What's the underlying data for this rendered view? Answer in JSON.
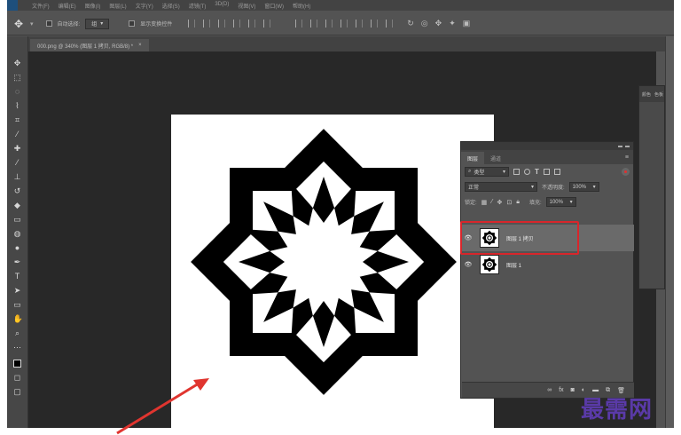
{
  "app": {
    "menus": [
      "文件(F)",
      "编辑(E)",
      "图像(I)",
      "图层(L)",
      "文字(Y)",
      "选择(S)",
      "滤镜(T)",
      "3D(D)",
      "视图(V)",
      "窗口(W)",
      "帮助(H)"
    ]
  },
  "options": {
    "auto_select_label": "自动选择:",
    "auto_select_value": "组",
    "show_transform_label": "显示变换控件"
  },
  "document": {
    "tab_title": "000.png @ 340% (图层 1 拷贝, RGB/8) *",
    "close_glyph": "×"
  },
  "colors": {
    "highlight": "#d8262b",
    "arrow": "#e0352f",
    "watermark": "#5a3aa8",
    "toggle_dot": "#e03030"
  },
  "panel2": {
    "tab_a": "颜色",
    "tab_b": "色板"
  },
  "layers_panel": {
    "tab_layers": "图层",
    "tab_channels": "通道",
    "menu_icon": "hamburger-menu-icon",
    "filter_kind_label": "类型",
    "blend_mode": "正常",
    "opacity_label": "不透明度:",
    "opacity_value": "100%",
    "lock_label": "锁定:",
    "fill_label": "填充:",
    "fill_value": "100%",
    "layers": [
      {
        "name": "图层 1 拷贝",
        "selected": true,
        "visible": true
      },
      {
        "name": "图层 1",
        "selected": false,
        "visible": true
      }
    ],
    "footer_icons": [
      "link-icon",
      "fx-icon",
      "mask-icon",
      "adjustment-icon",
      "folder-icon",
      "new-layer-icon",
      "trash-icon"
    ]
  },
  "watermark": "最需网"
}
